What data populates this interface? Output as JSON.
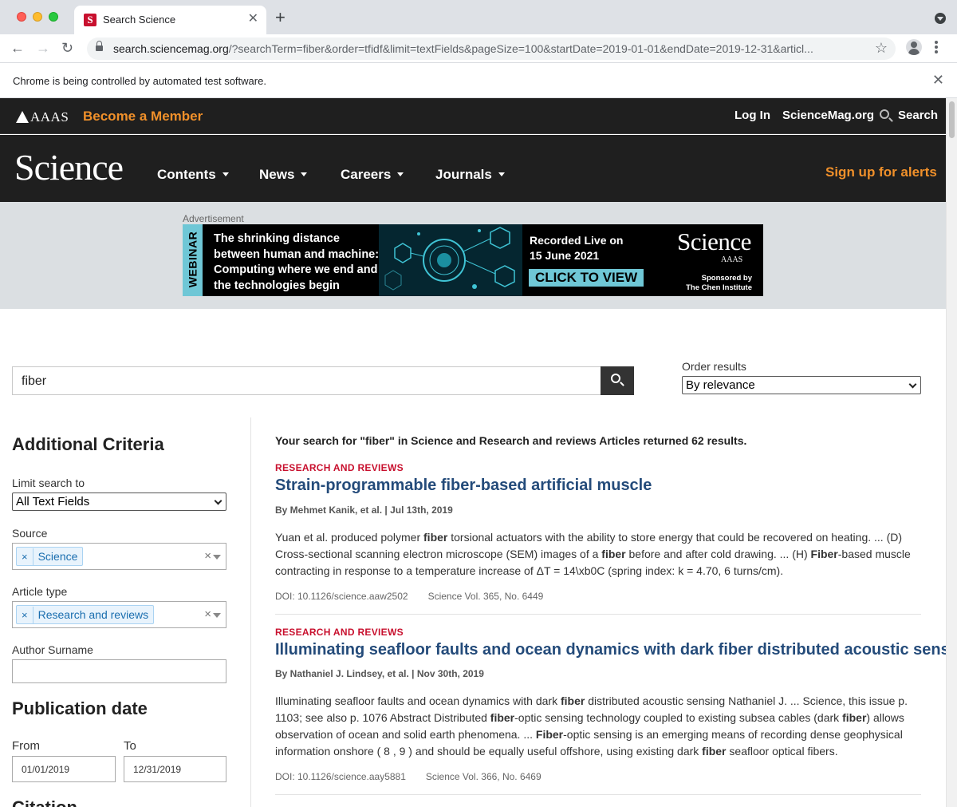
{
  "browser": {
    "tab_title": "Search Science",
    "tab_favicon": "S",
    "new_tab_icon": "plus-icon",
    "url_host": "search.sciencemag.org",
    "url_rest": "/?searchTerm=fiber&order=tfidf&limit=textFields&pageSize=100&startDate=2019-01-01&endDate=2019-12-31&articl...",
    "infobar_text": "Chrome is being controlled by automated test software."
  },
  "topbar": {
    "logo": "AAAS",
    "become_member": "Become a Member",
    "login": "Log In",
    "sciencemag": "ScienceMag.org",
    "search": "Search"
  },
  "navbar": {
    "logo": "Science",
    "items": [
      "Contents",
      "News",
      "Careers",
      "Journals"
    ],
    "signup": "Sign up for alerts"
  },
  "ad": {
    "label": "Advertisement",
    "side": "WEBINAR",
    "headline": "The shrinking distance between human and machine: Computing where we end and the technologies begin",
    "recorded_line1": "Recorded Live on",
    "recorded_line2": "15 June 2021",
    "cta": "CLICK TO VIEW",
    "brand": "Science",
    "brand_sub": "AAAS",
    "sponsor_line1": "Sponsored by",
    "sponsor_line2": "The Chen Institute"
  },
  "search": {
    "query": "fiber",
    "order_label": "Order results",
    "order_value": "By relevance"
  },
  "sidebar": {
    "heading": "Additional Criteria",
    "limit_label": "Limit search to",
    "limit_value": "All Text Fields",
    "source_label": "Source",
    "source_chip": "Science",
    "article_type_label": "Article type",
    "article_type_chip": "Research and reviews",
    "author_label": "Author Surname",
    "pubdate_heading": "Publication date",
    "from_label": "From",
    "from_value": "01/01/2019",
    "to_label": "To",
    "to_value": "12/31/2019",
    "citation_heading": "Citation"
  },
  "results": {
    "summary": "Your search for \"fiber\" in Science and Research and reviews Articles returned 62 results.",
    "items": [
      {
        "kicker": "RESEARCH AND REVIEWS",
        "title": "Strain-programmable fiber-based artificial muscle",
        "byline": "By Mehmet Kanik, et al. | Jul 13th, 2019",
        "snippet_html": "Yuan et al. produced polymer <b>fiber</b> torsional actuators with the ability to store energy that could be recovered on heating. ... (D) Cross-sectional scanning electron microscope (SEM) images of a <b>fiber</b> before and after cold drawing. ... (H) <b>Fiber</b>-based muscle contracting in response to a temperature increase of ΔT = 14\\xb0C (spring index: k = 4.70, 6 turns/cm).",
        "doi": "DOI: 10.1126/science.aaw2502",
        "volume": "Science Vol. 365, No. 6449"
      },
      {
        "kicker": "RESEARCH AND REVIEWS",
        "title": "Illuminating seafloor faults and ocean dynamics with dark fiber distributed acoustic sensing",
        "byline": "By Nathaniel J. Lindsey, et al. | Nov 30th, 2019",
        "snippet_html": "Illuminating seafloor faults and ocean dynamics with dark <b>fiber</b> distributed acoustic sensing Nathaniel J. ... Science, this issue p. 1103; see also p. 1076 Abstract Distributed <b>fiber</b>-optic sensing technology coupled to existing subsea cables (dark <b>fiber</b>) allows observation of ocean and solid earth phenomena. ... <b>Fiber</b>-optic sensing is an emerging means of recording dense geophysical information onshore ( 8 , 9 ) and should be equally useful offshore, using existing dark <b>fiber</b> seafloor optical fibers.",
        "doi": "DOI: 10.1126/science.aay5881",
        "volume": "Science Vol. 366, No. 6469"
      }
    ]
  }
}
